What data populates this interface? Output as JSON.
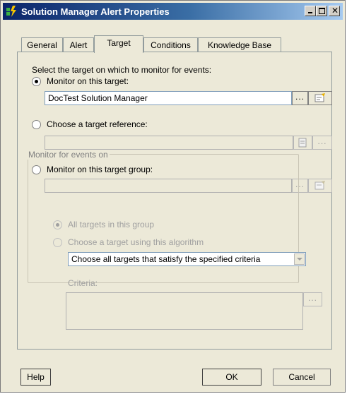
{
  "window": {
    "title": "Solution Manager Alert Properties"
  },
  "tabs": [
    {
      "label": "General"
    },
    {
      "label": "Alert"
    },
    {
      "label": "Target"
    },
    {
      "label": "Conditions"
    },
    {
      "label": "Knowledge Base"
    }
  ],
  "target": {
    "intro": "Select the target on which to monitor for events:",
    "option_monitor_target": "Monitor on this target:",
    "target_value": "DocTest Solution Manager",
    "option_reference": "Choose a target reference:",
    "reference_value": "",
    "option_group": "Monitor on this target group:",
    "group_value": "",
    "browse_label": "...",
    "group_box": {
      "title": "Monitor for events on",
      "all_targets": "All targets in this group",
      "algorithm": "Choose a target using this algorithm",
      "algorithm_selected": "Choose all targets that satisfy the specified criteria",
      "criteria_label": "Criteria:",
      "criteria_value": ""
    }
  },
  "buttons": {
    "help": "Help",
    "ok": "OK",
    "cancel": "Cancel"
  }
}
